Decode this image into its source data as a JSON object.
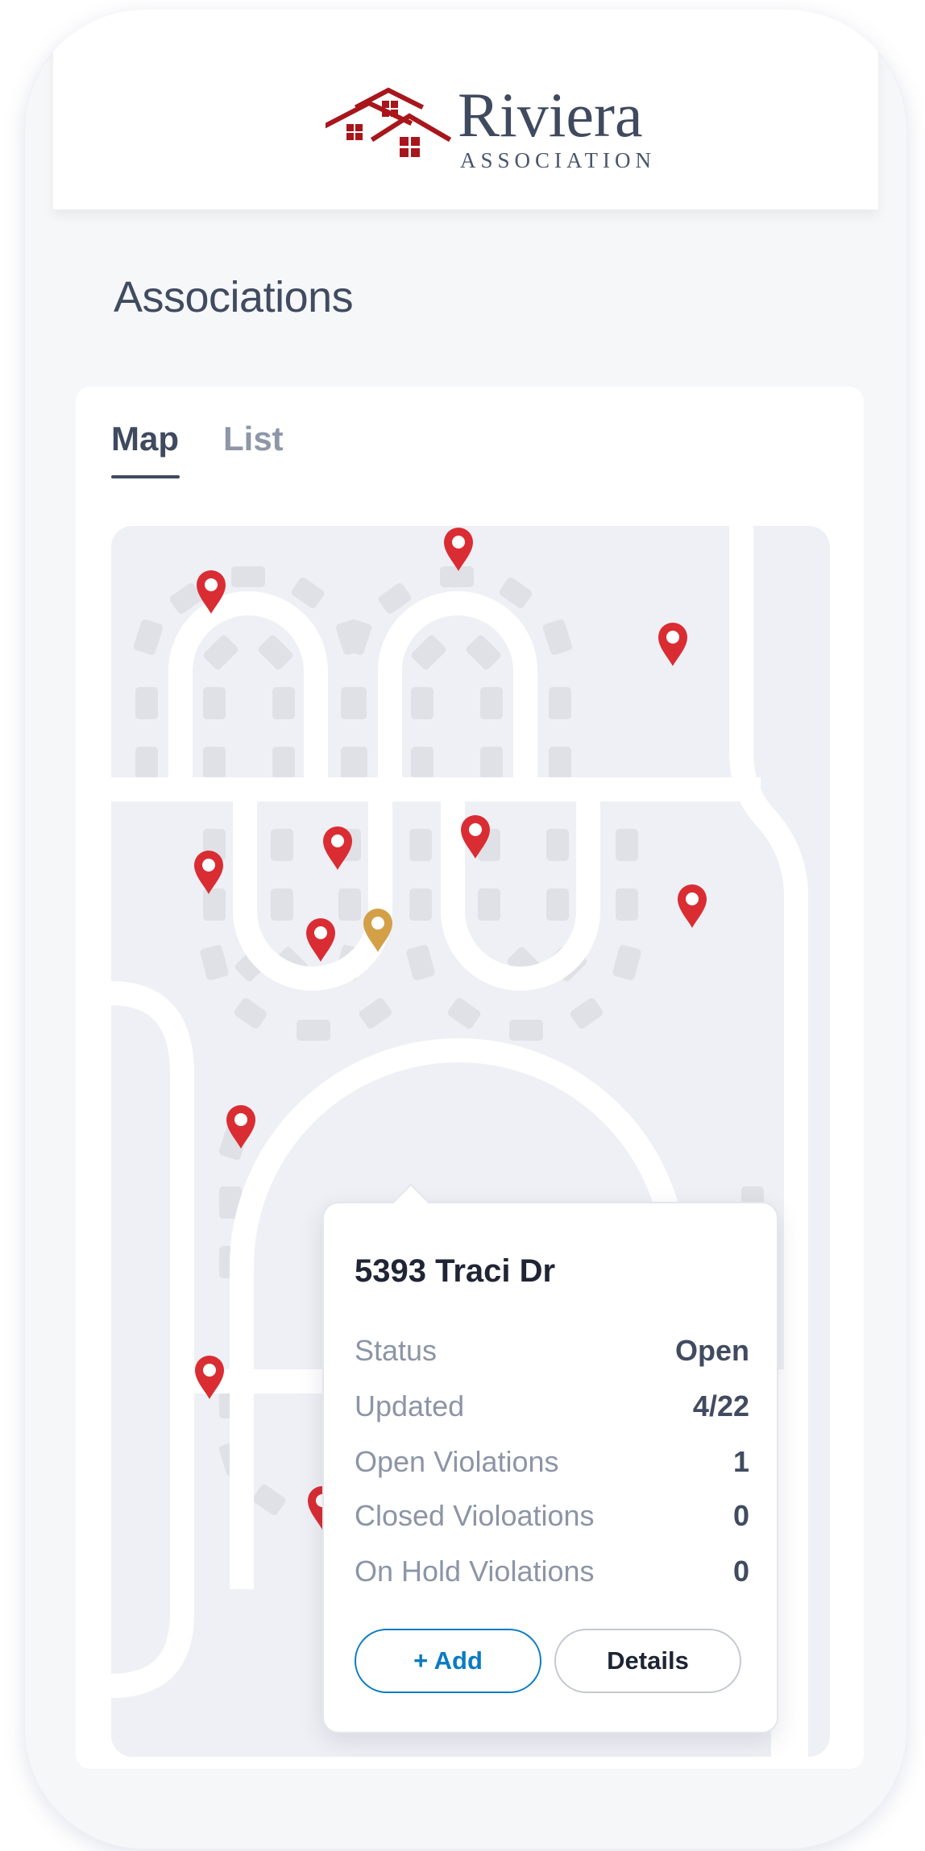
{
  "brand": {
    "name": "Riviera",
    "subtitle": "ASSOCIATION",
    "colors": {
      "logo_red": "#a8161b",
      "logo_text": "#3f4a5f"
    }
  },
  "page": {
    "title": "Associations"
  },
  "tabs": [
    {
      "label": "Map",
      "active": true
    },
    {
      "label": "List",
      "active": false
    }
  ],
  "map": {
    "pin_icon": "map-marker-icon",
    "colors": {
      "pin_default": "#d92d33",
      "pin_selected": "#d3a048",
      "road": "#ffffff",
      "lot": "#dfe1e6",
      "ground": "#eef0f5"
    }
  },
  "popup": {
    "address": "5393 Traci Dr",
    "rows": [
      {
        "label": "Status",
        "value": "Open"
      },
      {
        "label": "Updated",
        "value": "4/22"
      },
      {
        "label": "Open Violations",
        "value": "1"
      },
      {
        "label": "Closed Violoations",
        "value": "0"
      },
      {
        "label": "On Hold Violations",
        "value": "0"
      }
    ],
    "add_label": "+ Add",
    "details_label": "Details",
    "colors": {
      "add_accent": "#0a7bc2"
    }
  }
}
